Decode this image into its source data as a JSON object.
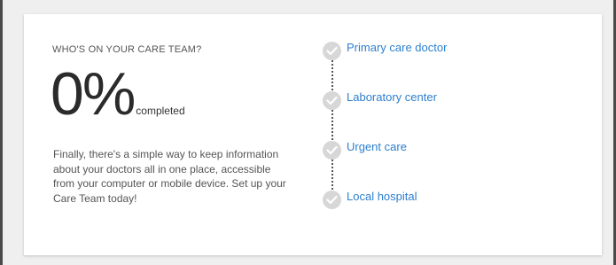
{
  "card": {
    "title": "WHO'S ON YOUR CARE TEAM?",
    "progress_value": "0%",
    "progress_label": "completed",
    "description": "Finally, there's a simple way to keep information about your doctors all in one place, accessible from your computer or mobile device. Set up your Care Team today!"
  },
  "care_team": {
    "items": [
      {
        "label": "Primary care doctor",
        "icon": "check-circle-icon",
        "completed": false
      },
      {
        "label": "Laboratory center",
        "icon": "check-circle-icon",
        "completed": false
      },
      {
        "label": "Urgent care",
        "icon": "check-circle-icon",
        "completed": false
      },
      {
        "label": "Local hospital",
        "icon": "check-circle-icon",
        "completed": false
      }
    ]
  },
  "colors": {
    "link": "#2d7fcf",
    "check_inactive": "#d7d7d7",
    "background": "#efefef",
    "card": "#ffffff"
  }
}
